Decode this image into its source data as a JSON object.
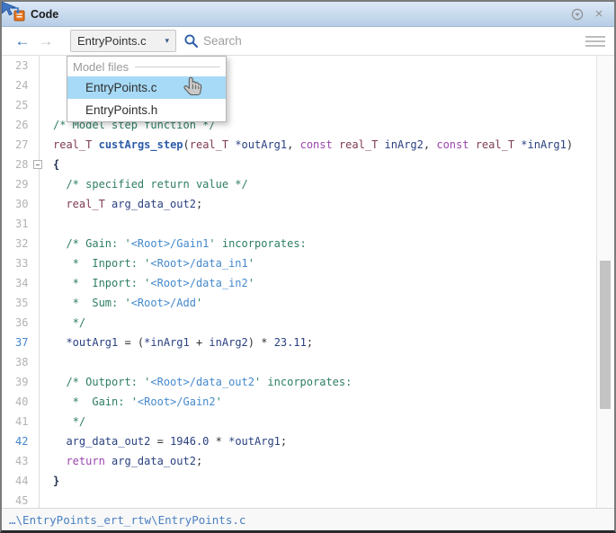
{
  "titlebar": {
    "title": "Code",
    "icons": [
      "code-panel-icon",
      "dock-menu-icon",
      "close-icon",
      "mouse-cursor-arrow"
    ]
  },
  "toolbar": {
    "back_label": "←",
    "forward_label": "→",
    "file_selector": {
      "value": "EntryPoints.c",
      "caret": "▾"
    },
    "search": {
      "placeholder": "Search"
    },
    "icons": [
      "back-arrow-icon",
      "forward-arrow-icon",
      "search-icon",
      "hamburger-menu-icon"
    ]
  },
  "dropdown": {
    "header": "Model files",
    "items": [
      {
        "label": "EntryPoints.c",
        "selected": true,
        "cursor": "hand-pointer"
      },
      {
        "label": "EntryPoints.h",
        "selected": false
      }
    ]
  },
  "editor": {
    "visible_line_range": [
      23,
      45
    ],
    "lines": [
      {
        "n": 23,
        "tokens": []
      },
      {
        "n": 24,
        "tokens": []
      },
      {
        "n": 25,
        "tokens": []
      },
      {
        "n": 26,
        "tokens": [
          {
            "c": "cm",
            "t": "/* Model step function */"
          }
        ]
      },
      {
        "n": 27,
        "tokens": [
          {
            "c": "ty",
            "t": "real_T"
          },
          {
            "c": "pl",
            "t": " "
          },
          {
            "c": "fn",
            "t": "custArgs_step"
          },
          {
            "c": "pl",
            "t": "("
          },
          {
            "c": "ty",
            "t": "real_T"
          },
          {
            "c": "id",
            "t": " *outArg1"
          },
          {
            "c": "pl",
            "t": ", "
          },
          {
            "c": "kw",
            "t": "const"
          },
          {
            "c": "pl",
            "t": " "
          },
          {
            "c": "ty",
            "t": "real_T"
          },
          {
            "c": "id",
            "t": " inArg2"
          },
          {
            "c": "pl",
            "t": ", "
          },
          {
            "c": "kw",
            "t": "const"
          },
          {
            "c": "pl",
            "t": " "
          },
          {
            "c": "ty",
            "t": "real_T"
          },
          {
            "c": "id",
            "t": " *inArg1"
          },
          {
            "c": "pl",
            "t": ")"
          }
        ]
      },
      {
        "n": 28,
        "fold": true,
        "tokens": [
          {
            "c": "br",
            "t": "{"
          }
        ]
      },
      {
        "n": 29,
        "tokens": [
          {
            "c": "cm",
            "t": "  /* specified return value */"
          }
        ]
      },
      {
        "n": 30,
        "tokens": [
          {
            "c": "pl",
            "t": "  "
          },
          {
            "c": "ty",
            "t": "real_T"
          },
          {
            "c": "id",
            "t": " arg_data_out2"
          },
          {
            "c": "pl",
            "t": ";"
          }
        ]
      },
      {
        "n": 31,
        "tokens": []
      },
      {
        "n": 32,
        "tokens": [
          {
            "c": "cm",
            "t": "  /* Gain: '"
          },
          {
            "c": "lk",
            "t": "<Root>/Gain1"
          },
          {
            "c": "cm",
            "t": "' incorporates:"
          }
        ]
      },
      {
        "n": 33,
        "tokens": [
          {
            "c": "cm",
            "t": "   *  Inport: '"
          },
          {
            "c": "lk",
            "t": "<Root>/data_in1"
          },
          {
            "c": "cm",
            "t": "'"
          }
        ]
      },
      {
        "n": 34,
        "tokens": [
          {
            "c": "cm",
            "t": "   *  Inport: '"
          },
          {
            "c": "lk",
            "t": "<Root>/data_in2"
          },
          {
            "c": "cm",
            "t": "'"
          }
        ]
      },
      {
        "n": 35,
        "tokens": [
          {
            "c": "cm",
            "t": "   *  Sum: '"
          },
          {
            "c": "lk",
            "t": "<Root>/Add"
          },
          {
            "c": "cm",
            "t": "'"
          }
        ]
      },
      {
        "n": 36,
        "tokens": [
          {
            "c": "cm",
            "t": "   */"
          }
        ]
      },
      {
        "n": 37,
        "hl": true,
        "tokens": [
          {
            "c": "id",
            "t": "  *outArg1"
          },
          {
            "c": "pl",
            "t": " = ("
          },
          {
            "c": "id",
            "t": "*inArg1"
          },
          {
            "c": "pl",
            "t": " + "
          },
          {
            "c": "id",
            "t": "inArg2"
          },
          {
            "c": "pl",
            "t": ") * "
          },
          {
            "c": "id",
            "t": "23.11"
          },
          {
            "c": "pl",
            "t": ";"
          }
        ]
      },
      {
        "n": 38,
        "tokens": []
      },
      {
        "n": 39,
        "tokens": [
          {
            "c": "cm",
            "t": "  /* Outport: '"
          },
          {
            "c": "lk",
            "t": "<Root>/data_out2"
          },
          {
            "c": "cm",
            "t": "' incorporates:"
          }
        ]
      },
      {
        "n": 40,
        "tokens": [
          {
            "c": "cm",
            "t": "   *  Gain: '"
          },
          {
            "c": "lk",
            "t": "<Root>/Gain2"
          },
          {
            "c": "cm",
            "t": "'"
          }
        ]
      },
      {
        "n": 41,
        "tokens": [
          {
            "c": "cm",
            "t": "   */"
          }
        ]
      },
      {
        "n": 42,
        "hl": true,
        "tokens": [
          {
            "c": "id",
            "t": "  arg_data_out2"
          },
          {
            "c": "pl",
            "t": " = "
          },
          {
            "c": "id",
            "t": "1946.0"
          },
          {
            "c": "pl",
            "t": " * "
          },
          {
            "c": "id",
            "t": "*outArg1"
          },
          {
            "c": "pl",
            "t": ";"
          }
        ]
      },
      {
        "n": 43,
        "tokens": [
          {
            "c": "pl",
            "t": "  "
          },
          {
            "c": "kw",
            "t": "return"
          },
          {
            "c": "id",
            "t": " arg_data_out2"
          },
          {
            "c": "pl",
            "t": ";"
          }
        ]
      },
      {
        "n": 44,
        "tokens": [
          {
            "c": "br",
            "t": "}"
          }
        ]
      },
      {
        "n": 45,
        "tokens": []
      }
    ]
  },
  "statusbar": {
    "path": "…\\EntryPoints_ert_rtw\\EntryPoints.c"
  },
  "colors": {
    "titlebar_top": "#dce9f7",
    "titlebar_bottom": "#b7cee6",
    "selected_item_blue": "#a6daf6",
    "comment_green": "#2d7d64",
    "comment_link_blue": "#4489cc",
    "type_maroon": "#7f3b4f",
    "keyword_purple": "#9b44ae",
    "function_blue": "#2d5ca8",
    "identifier_navy": "#2a4080",
    "line_number_gray": "#b2b2b2",
    "line_number_highlight": "#4285d0",
    "status_path_blue": "#4a80c2",
    "panel_icon_orange": "#e87722"
  }
}
